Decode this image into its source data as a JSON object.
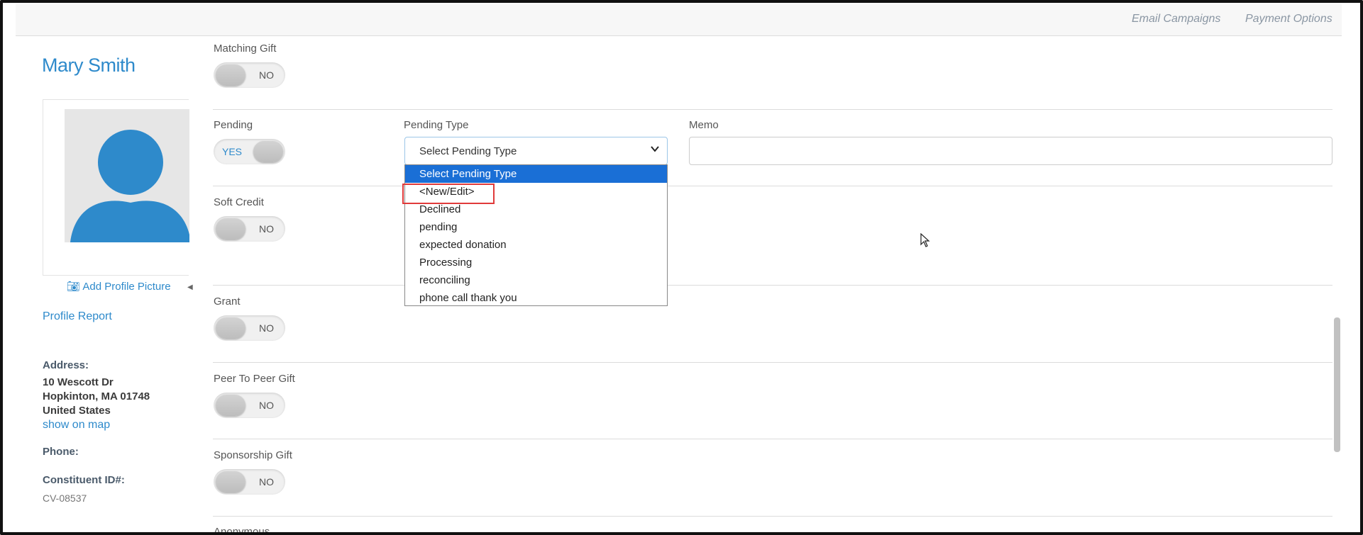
{
  "topnav": {
    "links": [
      "Email Campaigns",
      "Payment Options"
    ]
  },
  "profile": {
    "name": "Mary Smith",
    "add_picture": "Add Profile Picture",
    "profile_report": "Profile Report",
    "address_label": "Address:",
    "address_line1": "10 Wescott Dr",
    "address_line2": "Hopkinton, MA 01748",
    "address_line3": "United States",
    "map_link": "show on map",
    "phone_label": "Phone:",
    "constituent_label": "Constituent ID#:",
    "constituent_id": "CV-08537"
  },
  "form": {
    "matching_gift": {
      "label": "Matching Gift",
      "state": "NO"
    },
    "pending": {
      "label": "Pending",
      "state": "YES"
    },
    "pending_type": {
      "label": "Pending Type",
      "selected": "Select Pending Type",
      "options": [
        "Select Pending Type",
        "<New/Edit>",
        "Declined",
        "pending",
        "expected donation",
        "Processing",
        "reconciling",
        "phone call thank you"
      ]
    },
    "memo": {
      "label": "Memo",
      "value": ""
    },
    "soft_credit": {
      "label": "Soft Credit",
      "state": "NO"
    },
    "grant": {
      "label": "Grant",
      "state": "NO"
    },
    "peer_to_peer": {
      "label": "Peer To Peer Gift",
      "state": "NO"
    },
    "sponsorship": {
      "label": "Sponsorship Gift",
      "state": "NO"
    },
    "anonymous": {
      "label": "Anonymous"
    }
  },
  "colors": {
    "link": "#2e8acb",
    "selected_option": "#1a6fd6",
    "highlight": "#e03a3a"
  }
}
